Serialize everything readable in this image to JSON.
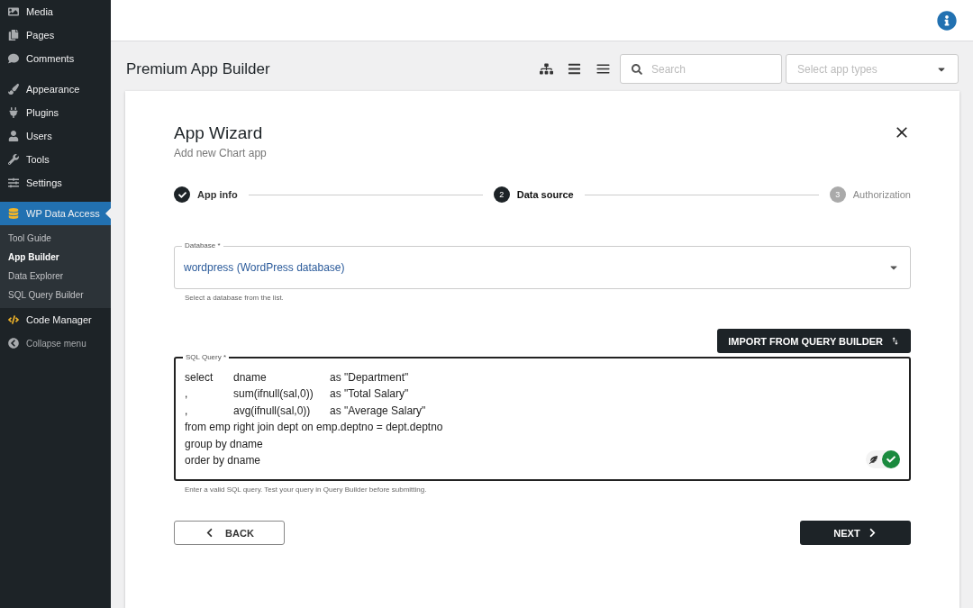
{
  "sidebar": {
    "items": [
      {
        "label": "Media",
        "selected": false
      },
      {
        "label": "Pages",
        "selected": false
      },
      {
        "label": "Comments",
        "selected": false
      },
      {
        "label": "Appearance",
        "selected": false
      },
      {
        "label": "Plugins",
        "selected": false
      },
      {
        "label": "Users",
        "selected": false
      },
      {
        "label": "Tools",
        "selected": false
      },
      {
        "label": "Settings",
        "selected": false
      },
      {
        "label": "WP Data Access",
        "selected": true,
        "children": [
          {
            "label": "Tool Guide",
            "selected": false
          },
          {
            "label": "App Builder",
            "selected": true
          },
          {
            "label": "Data Explorer",
            "selected": false
          },
          {
            "label": "SQL Query Builder",
            "selected": false
          }
        ]
      },
      {
        "label": "Code Manager",
        "selected": false
      }
    ],
    "collapse": "Collapse menu"
  },
  "page": {
    "title": "Premium App Builder",
    "search": {
      "placeholder": "Search"
    },
    "app_types": {
      "placeholder": "Select app types"
    }
  },
  "wizard": {
    "title": "App Wizard",
    "subtitle": "Add new Chart app",
    "steps": [
      {
        "label": "App info",
        "completed": true,
        "selected": false
      },
      {
        "label": "Data source",
        "number": "2",
        "completed": false,
        "selected": true
      },
      {
        "label": "Authorization",
        "number": "3",
        "completed": false,
        "selected": false
      }
    ],
    "database": {
      "label": "Database *",
      "value": "wordpress (WordPress database)",
      "helper": "Select a database from the list."
    },
    "import_button": "IMPORT FROM QUERY BUILDER",
    "query": {
      "label": "SQL Query *",
      "lines": [
        [
          "select",
          "dname",
          "as \"Department\""
        ],
        [
          ",",
          "sum(ifnull(sal,0))",
          "as \"Total Salary\""
        ],
        [
          ",",
          "avg(ifnull(sal,0))",
          "as \"Average Salary\""
        ],
        [
          "from emp right join dept on emp.deptno = dept.deptno"
        ],
        [
          "group by dname"
        ],
        [
          "order by dname"
        ]
      ],
      "helper": "Enter a valid SQL query. Test your query in Query Builder before submitting.",
      "validate_on": true
    },
    "back": "BACK",
    "next": "NEXT"
  }
}
